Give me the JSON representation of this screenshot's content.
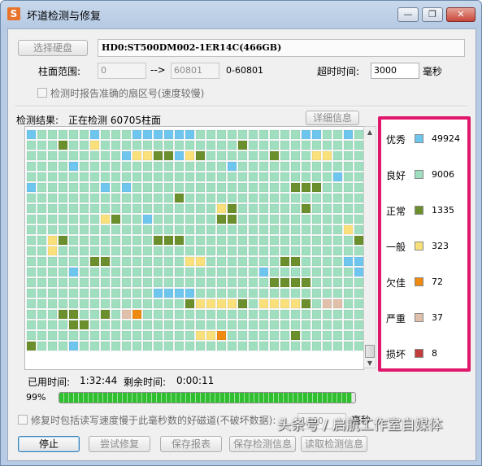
{
  "window": {
    "title": "坏道检测与修复",
    "app_icon_glyph": "S",
    "min_glyph": "—",
    "max_glyph": "❐",
    "close_glyph": "✕"
  },
  "disk": {
    "select_button": "选择硬盘",
    "drive_label": "HD0:ST500DM002-1ER14C(466GB)"
  },
  "range": {
    "label": "柱面范围:",
    "start": "0",
    "arrow": "-->",
    "end": "60801",
    "total": "0-60801",
    "timeout_label": "超时时间:",
    "timeout_value": "3000",
    "timeout_unit": "毫秒"
  },
  "report_sector_option": "检测时报告准确的扇区号(速度较慢)",
  "results": {
    "label": "检测结果:",
    "status": "正在检测 60705柱面",
    "details_button": "详细信息"
  },
  "legend": [
    {
      "name": "优秀",
      "count": "49924",
      "color": "#6ec6ee"
    },
    {
      "name": "良好",
      "count": "9006",
      "color": "#9fdfc0"
    },
    {
      "name": "正常",
      "count": "1335",
      "color": "#6a8f2c"
    },
    {
      "name": "一般",
      "count": "323",
      "color": "#f9e07a"
    },
    {
      "name": "欠佳",
      "count": "72",
      "color": "#ee8a12"
    },
    {
      "name": "严重",
      "count": "37",
      "color": "#e0c0aa"
    },
    {
      "name": "损坏",
      "count": "8",
      "color": "#c43d3d"
    }
  ],
  "grid": {
    "blank_color": "#ffffff",
    "rows": [
      "ABBBBBABBBAAAAAABBBBBBBBBBAABBAB",
      "BBBCBBDBBBBBBBBBBBBBCBBBBBBBBBBB",
      "BBBBBBBBBADDCCADCBBBBBBCBBBDDBBB",
      "BBBBABBBBBBBBBBBBBBABBBBBBBBBBBB",
      "BBBBBBBBBBBBBBBBBBBBBBBBBBBBBABB",
      "ABBBBBBABABBBBBBBBBBBBBBBCCCBBBB",
      "BBBBBBBBBBBBBBCBBBBBBBBBBBBBBBBB",
      "BBBBBBBBBBBBBBBBBBDCBBBBBBCBBBBB",
      "BBBBBBBDCBBABBBBBBCCBBBBBBBBBBBB",
      "BBBBBBBBBBBBBBBBBBBBBBBBBBBBBBDB",
      "BBDCBBBBBBBBCCCBBBBBBBBBBBBBBBBC",
      "BBDBBBBBBBBBBBBBBBBBBBBBBBBBBBBB",
      "BBBBBBCCBBBBBBBDDBBBBBBBCCBBBBAA",
      "BBBBABBBBBBBBBBBBBBBBBABBBBBBBBA",
      "BBBBBBBBBBBBBBBBBBBBBBBCCCCBBBBB",
      "BBBBBBBBBBBBAAAABBBBBBBBBBBBBBBB",
      "BBBBBBBBBBBBBBBCDDDDCBDDDDCBFFBB",
      "BBBCCBBCBFEBBBBBBBBBBBBBBBBBBBBB",
      "BBBBCCBBBBBBBBBBBBBBBBBBBBBBBBBB",
      "BBBBBBBBBBBBBBBBDDEBBBBBBCBBBBBB",
      "CBBBABBBBBBBBBBBBBBBBBBBBBBBBBBB"
    ]
  },
  "time": {
    "used_label": "已用时间:",
    "used": "1:32:44",
    "remaining_label": "剩余时间:",
    "remaining": "0:00:11"
  },
  "progress": {
    "percent_text": "99%",
    "fraction": 0.99
  },
  "repair_option": {
    "label": "修复时包括读写速度慢于此毫秒数的好磁道(不破坏数据):",
    "value": "1460",
    "unit": "毫秒"
  },
  "buttons": {
    "stop": "停止",
    "try_repair": "尝试修复",
    "save_report": "保存报表",
    "save_info": "保存检测信息",
    "read_info": "读取检测信息"
  },
  "watermark": "头条号 / 启航工作室自媒体"
}
